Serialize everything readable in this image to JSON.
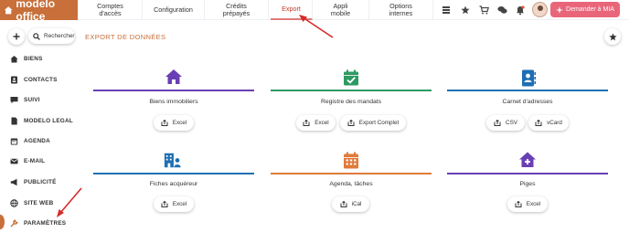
{
  "brand": {
    "name": "modelo office",
    "color": "#c86f3a"
  },
  "nav": [
    {
      "label": "Comptes\nd'accès"
    },
    {
      "label": "Configuration"
    },
    {
      "label": "Crédits\nprépayés"
    },
    {
      "label": "Export",
      "active": true
    },
    {
      "label": "Appli\nmobile"
    },
    {
      "label": "Options\ninternes"
    }
  ],
  "topicons": [
    "layers-icon",
    "star-icon",
    "cart-icon",
    "chat-icon",
    "bell-icon"
  ],
  "mia_button": "Demander à MIA",
  "search_label": "Rechercher",
  "page_title": "EXPORT DE DONNÉES",
  "sidebar": [
    {
      "label": "BIENS",
      "icon": "home-icon"
    },
    {
      "label": "CONTACTS",
      "icon": "contact-card-icon"
    },
    {
      "label": "SUIVI",
      "icon": "chat-icon"
    },
    {
      "label": "MODELO LEGAL",
      "icon": "document-icon"
    },
    {
      "label": "AGENDA",
      "icon": "calendar-icon"
    },
    {
      "label": "E-MAIL",
      "icon": "mail-icon"
    },
    {
      "label": "PUBLICITÉ",
      "icon": "megaphone-icon"
    },
    {
      "label": "SITE WEB",
      "icon": "globe-icon"
    },
    {
      "label": "PARAMÈTRES",
      "icon": "wrench-icon"
    }
  ],
  "cards": [
    {
      "title": "Biens immobiliers",
      "color": "#6a3fb5",
      "icon": "house-icon",
      "buttons": [
        "Excel"
      ]
    },
    {
      "title": "Registre des mandats",
      "color": "#2e9a63",
      "icon": "calendar-check-icon",
      "buttons": [
        "Excel",
        "Export Complet"
      ]
    },
    {
      "title": "Carnet d'adresses",
      "color": "#1e6fb3",
      "icon": "address-book-icon",
      "buttons": [
        "CSV",
        "vCard"
      ]
    },
    {
      "title": "Fiches acquéreur",
      "color": "#1e6fb3",
      "icon": "building-user-icon",
      "buttons": [
        "Excel"
      ]
    },
    {
      "title": "Agenda, tâches",
      "color": "#e07b3a",
      "icon": "calendar-icon",
      "buttons": [
        "iCal"
      ]
    },
    {
      "title": "Piges",
      "color": "#6a3fb5",
      "icon": "house-plus-icon",
      "buttons": [
        "Excel"
      ]
    }
  ]
}
